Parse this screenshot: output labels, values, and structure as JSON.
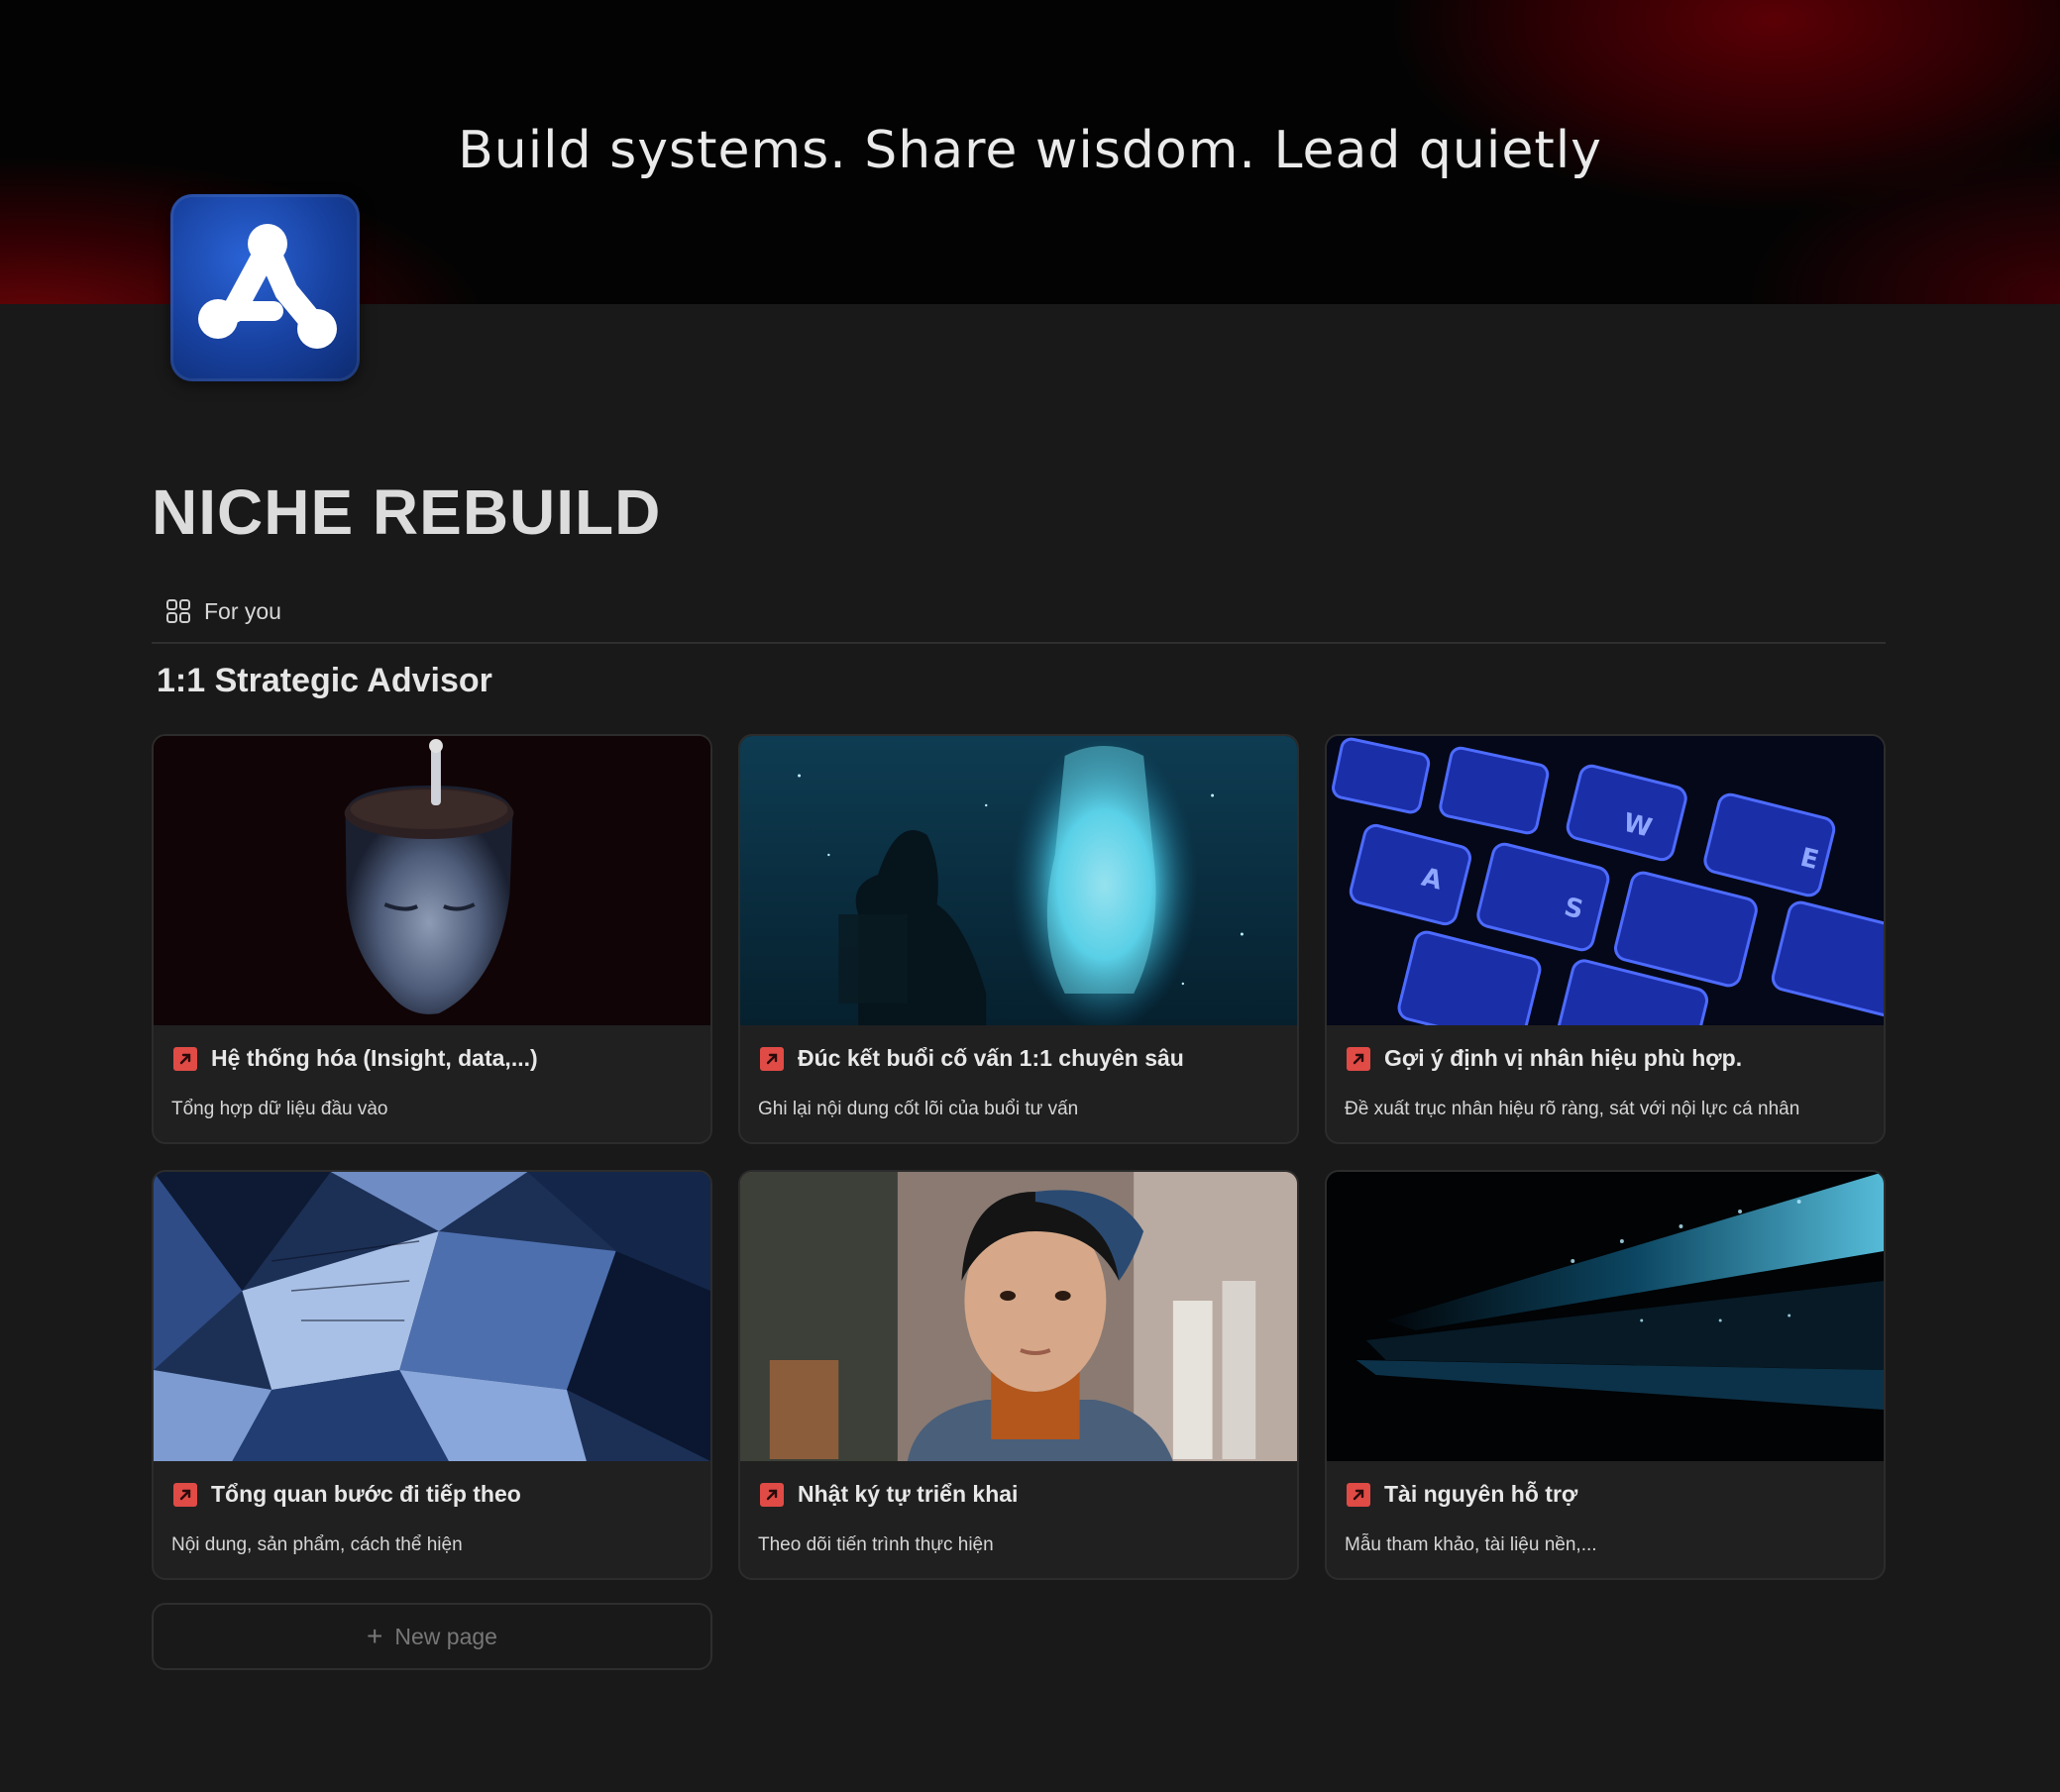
{
  "cover": {
    "tagline": "Build systems. Share wisdom. Lead quietly"
  },
  "page": {
    "title": "NICHE REBUILD"
  },
  "view_tab": {
    "label": "For you"
  },
  "section": {
    "title": "1:1 Strategic Advisor"
  },
  "cards": [
    {
      "title": "Hệ thống hóa (Insight, data,...)",
      "description": "Tổng hợp dữ liệu đầu vào"
    },
    {
      "title": "Đúc kết buổi cố vấn 1:1 chuyên sâu",
      "description": "Ghi lại nội dung cốt lõi của buổi tư vấn"
    },
    {
      "title": "Gợi ý định vị nhân hiệu phù hợp.",
      "description": "Đề xuất trục nhân hiệu rõ ràng, sát với nội lực cá nhân"
    },
    {
      "title": "Tổng quan bước đi tiếp theo",
      "description": "Nội dung, sản phẩm, cách thể hiện"
    },
    {
      "title": "Nhật ký tự triển khai",
      "description": "Theo dõi tiến trình thực hiện"
    },
    {
      "title": "Tài nguyên hỗ trợ",
      "description": "Mẫu tham khảo, tài liệu nền,..."
    }
  ],
  "new_page": {
    "label": "New page"
  },
  "colors": {
    "background": "#191919",
    "card": "#202020",
    "link_icon": "#e04b46",
    "logo": "#17409e"
  }
}
